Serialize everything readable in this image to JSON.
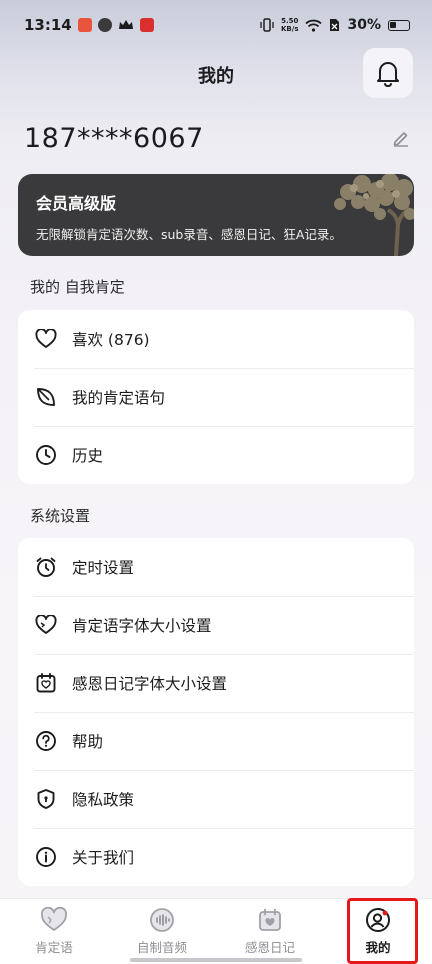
{
  "status_bar": {
    "time": "13:14",
    "net_speed": "5.50",
    "net_unit": "KB/s",
    "battery": "30%"
  },
  "header": {
    "title": "我的"
  },
  "profile": {
    "phone": "187****6067"
  },
  "vip": {
    "title": "会员高级版",
    "description": "无限解锁肯定语次数、sub录音、感恩日记、狂A记录。"
  },
  "section_affirm": {
    "label": "我的 自我肯定",
    "items": [
      {
        "label": "喜欢 (876)",
        "icon": "heart-icon"
      },
      {
        "label": "我的肯定语句",
        "icon": "leaf-icon"
      },
      {
        "label": "历史",
        "icon": "clock-icon"
      }
    ]
  },
  "section_settings": {
    "label": "系统设置",
    "items": [
      {
        "label": "定时设置",
        "icon": "alarm-icon"
      },
      {
        "label": "肯定语字体大小设置",
        "icon": "heart-outline-icon"
      },
      {
        "label": "感恩日记字体大小设置",
        "icon": "calendar-heart-icon"
      },
      {
        "label": "帮助",
        "icon": "help-icon"
      },
      {
        "label": "隐私政策",
        "icon": "shield-icon"
      },
      {
        "label": "关于我们",
        "icon": "info-icon"
      }
    ]
  },
  "tabbar": {
    "tabs": [
      {
        "label": "肯定语",
        "icon": "heart-tab-icon"
      },
      {
        "label": "自制音频",
        "icon": "audio-icon"
      },
      {
        "label": "感恩日记",
        "icon": "diary-icon"
      },
      {
        "label": "我的",
        "icon": "profile-icon"
      }
    ],
    "active_index": 3
  },
  "colors": {
    "vip_card": "#3a3a3c",
    "highlight": "#e5191c",
    "tab_active": "#1c1c1e",
    "tab_inactive": "#8e8e93"
  }
}
